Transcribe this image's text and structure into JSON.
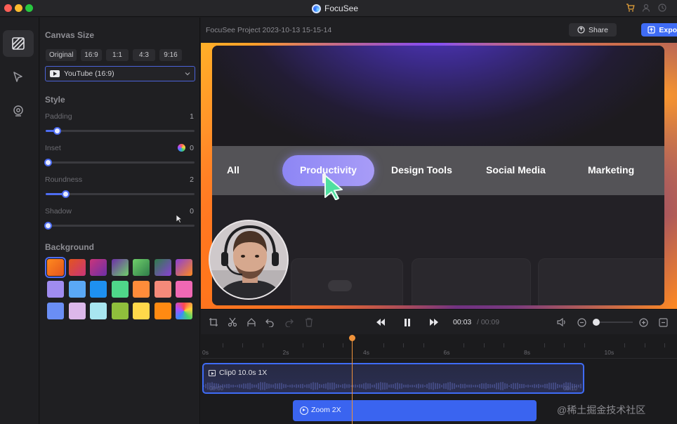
{
  "window": {
    "title": "FocuSee"
  },
  "sidebar_rail": {
    "items": [
      {
        "icon": "canvas-hatch-icon",
        "active": true
      },
      {
        "icon": "cursor-icon",
        "active": false
      },
      {
        "icon": "webcam-icon",
        "active": false
      }
    ]
  },
  "panel": {
    "canvas_size_title": "Canvas Size",
    "ratios": [
      "Original",
      "16:9",
      "1:1",
      "4:3",
      "9:16"
    ],
    "preset_selected": "YouTube (16:9)",
    "style_title": "Style",
    "sliders": [
      {
        "label": "Padding",
        "value": "1",
        "fraction": 0.06
      },
      {
        "label": "Inset",
        "value": "0",
        "fraction": 0.0
      },
      {
        "label": "Roundness",
        "value": "2",
        "fraction": 0.12
      },
      {
        "label": "Shadow",
        "value": "0",
        "fraction": 0.0
      }
    ],
    "background_title": "Background",
    "swatch_colors": [
      "#ff8a1e",
      "#e3541f",
      "#c9347a",
      "#6d2fa8",
      "#6fd06a",
      "#2f7d4a",
      "#8a3fd6",
      "#a08cf0",
      "#5aa8f5",
      "#1e90f0",
      "#4fd78a",
      "#ff8c3a",
      "#f58a7a",
      "#f068b4",
      "#6a8ef5",
      "#dcb8ea",
      "#a8e6f0",
      "#8fbf3c",
      "#ffd84a",
      "#ff8a12",
      "#f04aa8"
    ]
  },
  "project": {
    "name": "FocuSee Project 2023-10-13 15-15-14",
    "share_label": "Share",
    "export_label": "Export"
  },
  "preview": {
    "nav_items": [
      "All",
      "Productivity",
      "Design Tools",
      "Social Media",
      "Marketing"
    ],
    "active_nav": "Productivity"
  },
  "controls": {
    "current_time": "00:03",
    "total_time": "/ 00:09",
    "zoom_level": 0.0
  },
  "timeline": {
    "ticks": [
      "0s",
      "2s",
      "4s",
      "6s",
      "8s",
      "10s"
    ],
    "clip_label": "Clip0 10.0s 1X",
    "clip_start": "00:00",
    "clip_end": "00:10",
    "zoom_label": "Zoom 2X"
  },
  "watermark": "@稀土掘金技术社区",
  "colors": {
    "accent": "#3f6cf6",
    "playhead": "#f0923a"
  }
}
